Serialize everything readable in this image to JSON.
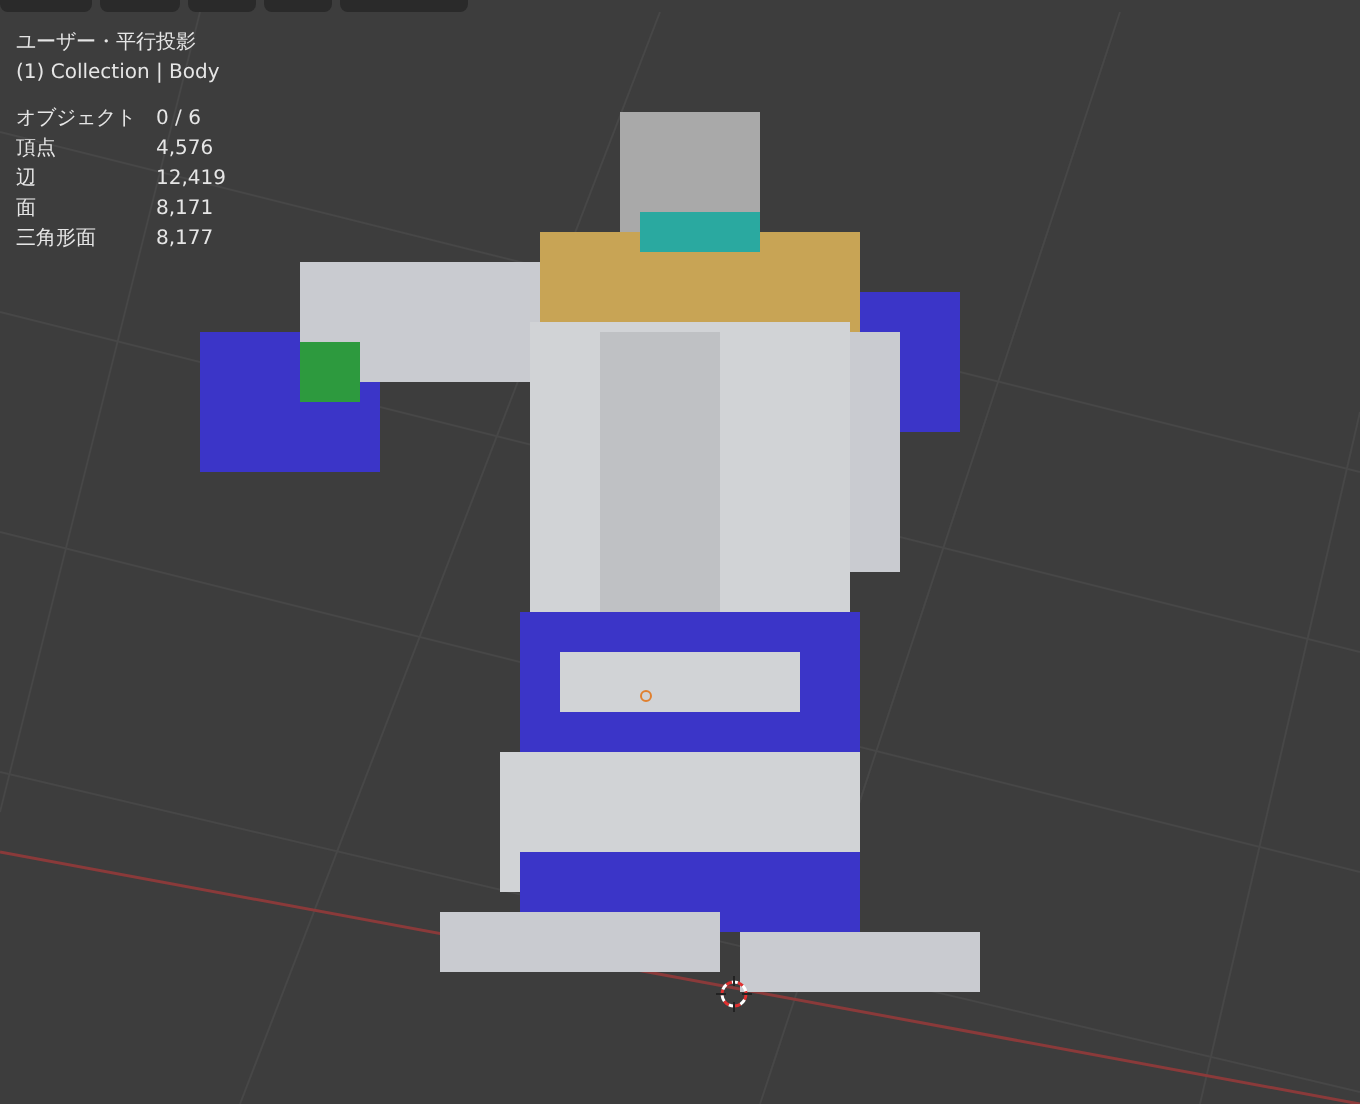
{
  "viewport": {
    "view_title": "ユーザー・平行投影",
    "collection_label": "(1) Collection | Body",
    "stats": [
      {
        "label": "オブジェクト",
        "value": "0 / 6"
      },
      {
        "label": "頂点",
        "value": "4,576"
      },
      {
        "label": "辺",
        "value": "12,419"
      },
      {
        "label": "面",
        "value": "8,171"
      },
      {
        "label": "三角形面",
        "value": "8,177"
      }
    ]
  }
}
